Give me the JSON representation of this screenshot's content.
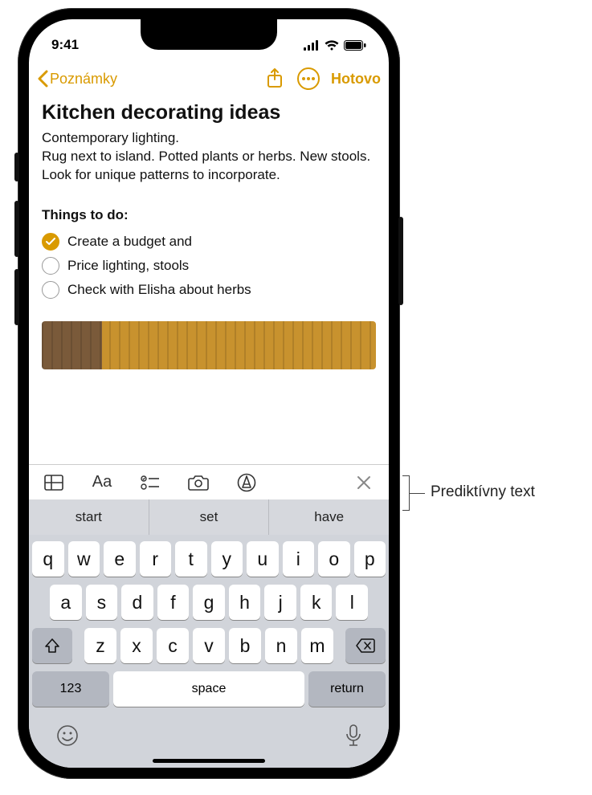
{
  "status": {
    "time": "9:41"
  },
  "nav": {
    "back_label": "Poznámky",
    "done_label": "Hotovo"
  },
  "note": {
    "title": "Kitchen decorating ideas",
    "body": "Contemporary lighting.\nRug next to island.  Potted plants or herbs. New stools. Look for unique patterns to incorporate.",
    "section_head": "Things to do:",
    "checklist": [
      {
        "label": "Create a budget and",
        "checked": true
      },
      {
        "label": "Price lighting, stools",
        "checked": false
      },
      {
        "label": "Check with Elisha about herbs",
        "checked": false
      }
    ]
  },
  "toolbar": {
    "aa": "Aa"
  },
  "predictions": [
    "start",
    "set",
    "have"
  ],
  "keyboard": {
    "row1": [
      "q",
      "w",
      "e",
      "r",
      "t",
      "y",
      "u",
      "i",
      "o",
      "p"
    ],
    "row2": [
      "a",
      "s",
      "d",
      "f",
      "g",
      "h",
      "j",
      "k",
      "l"
    ],
    "row3": [
      "z",
      "x",
      "c",
      "v",
      "b",
      "n",
      "m"
    ],
    "numbers": "123",
    "space": "space",
    "ret": "return"
  },
  "callout": {
    "label": "Prediktívny text"
  },
  "colors": {
    "accent": "#d99a00"
  }
}
